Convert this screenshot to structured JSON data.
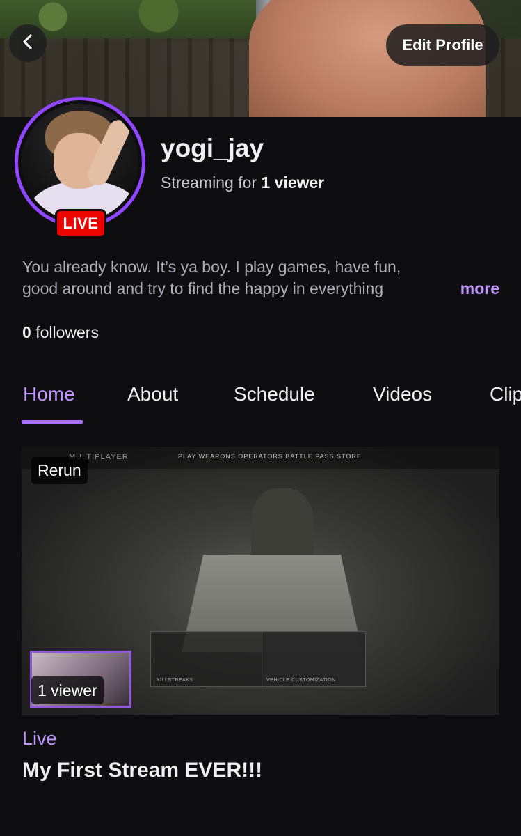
{
  "header": {
    "back_icon": "chevron-left-icon",
    "edit_profile_label": "Edit Profile"
  },
  "profile": {
    "username": "yogi_jay",
    "streaming_prefix": "Streaming for",
    "viewer_count": "1 viewer",
    "live_badge": "LIVE",
    "bio_line1": "You already know. It’s ya boy. I play games, have fun,",
    "bio_line2": "good around and try to find the happy in everything",
    "bio_more": "more",
    "followers_count": "0",
    "followers_label": "followers"
  },
  "tabs": [
    {
      "label": "Home",
      "active": true
    },
    {
      "label": "About",
      "active": false
    },
    {
      "label": "Schedule",
      "active": false
    },
    {
      "label": "Videos",
      "active": false
    },
    {
      "label": "Clips",
      "active": false
    }
  ],
  "stream_card": {
    "rerun_badge": "Rerun",
    "viewer_badge": "1 viewer",
    "status": "Live",
    "title": "My First Stream EVER!!!",
    "thumbnail_hud": {
      "mode": "MULTIPLAYER",
      "menu": "PLAY   WEAPONS   OPERATORS   BATTLE PASS   STORE",
      "panel_left": "KILLSTREAKS",
      "panel_right": "VEHICLE CUSTOMIZATION"
    }
  },
  "colors": {
    "accent": "#bf94ff",
    "tab_underline": "#a970ff",
    "live_red": "#eb0400",
    "background": "#0e0e10"
  }
}
